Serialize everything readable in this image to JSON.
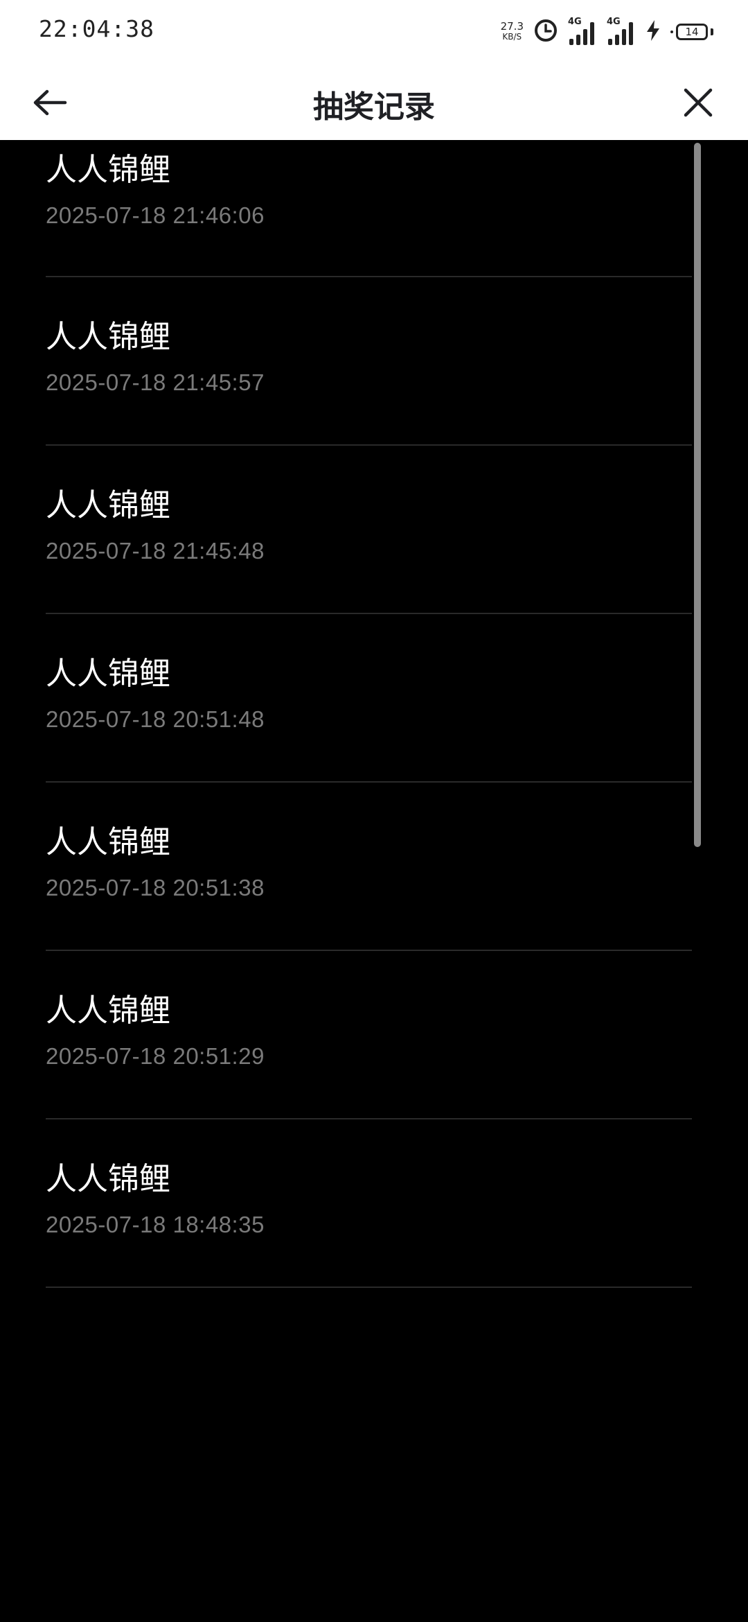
{
  "status_bar": {
    "time": "22:04:38",
    "net_speed_value": "27.3",
    "net_speed_unit": "KB/S",
    "signal_1_label": "4G",
    "signal_2_label": "4G",
    "battery_level": "14"
  },
  "header": {
    "title": "抽奖记录"
  },
  "records": [
    {
      "name": "人人锦鲤",
      "time": "2025-07-18 21:46:06"
    },
    {
      "name": "人人锦鲤",
      "time": "2025-07-18 21:45:57"
    },
    {
      "name": "人人锦鲤",
      "time": "2025-07-18 21:45:48"
    },
    {
      "name": "人人锦鲤",
      "time": "2025-07-18 20:51:48"
    },
    {
      "name": "人人锦鲤",
      "time": "2025-07-18 20:51:38"
    },
    {
      "name": "人人锦鲤",
      "time": "2025-07-18 20:51:29"
    },
    {
      "name": "人人锦鲤",
      "time": "2025-07-18 18:48:35"
    }
  ],
  "icons": {
    "back": "arrow-left-icon",
    "close": "close-icon",
    "alarm": "alarm-clock-icon",
    "charging": "lightning-icon"
  },
  "colors": {
    "background": "#000000",
    "header_bg": "#ffffff",
    "title_text": "#1f2024",
    "item_title": "#ffffff",
    "item_time": "#7a7a7a",
    "divider": "#2a2a2a"
  }
}
